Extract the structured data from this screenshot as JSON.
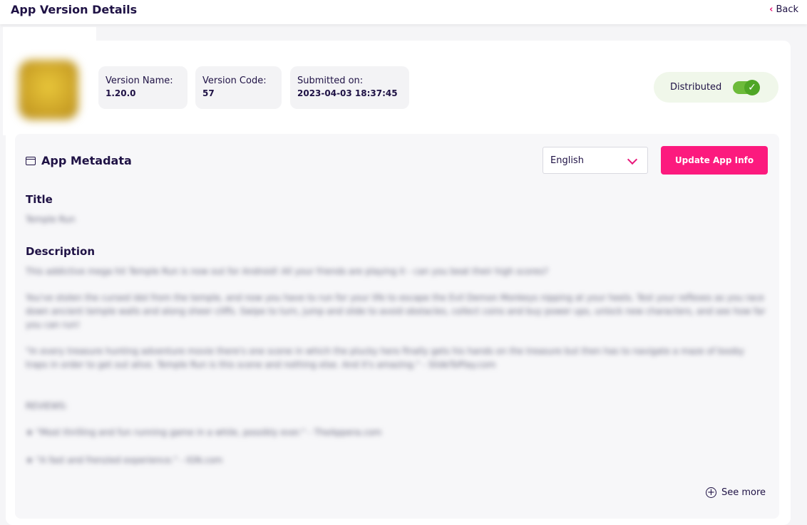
{
  "header": {
    "title": "App Version Details",
    "back_label": "Back"
  },
  "version": {
    "name_label": "Version Name:",
    "name_value": "1.20.0",
    "code_label": "Version Code:",
    "code_value": "57",
    "submitted_label": "Submitted on:",
    "submitted_value": "2023-04-03 18:37:45"
  },
  "distribution": {
    "label": "Distributed",
    "enabled": true
  },
  "metadata": {
    "title": "App Metadata",
    "language": "English",
    "update_button": "Update App Info",
    "title_label": "Title",
    "title_value": "Temple Run",
    "description_label": "Description",
    "description_paragraphs": [
      "This addictive mega hit Temple Run is now out for Android! All your friends are playing it - can you beat their high scores?",
      "You've stolen the cursed idol from the temple, and now you have to run for your life to escape the Evil Demon Monkeys nipping at your heels. Test your reflexes as you race down ancient temple walls and along sheer cliffs. Swipe to turn, jump and slide to avoid obstacles, collect coins and buy power ups, unlock new characters, and see how far you can run!",
      "\"In every treasure hunting adventure movie there's one scene in which the plucky hero finally gets his hands on the treasure but then has to navigate a maze of booby traps in order to get out alive. Temple Run is this scene and nothing else. And it's amazing.\" - SlideToPlay.com",
      "REVIEWS:",
      "★ \"Most thrilling and fun running game in a while, possibly ever.\" - TheAppera.com",
      "★ \"A fast and frenzied experience.\" - IGN.com"
    ],
    "see_more": "See more"
  },
  "colors": {
    "accent": "#fc1a7e",
    "toggle_on": "#6dbb3a",
    "text_dark": "#1f1245"
  }
}
